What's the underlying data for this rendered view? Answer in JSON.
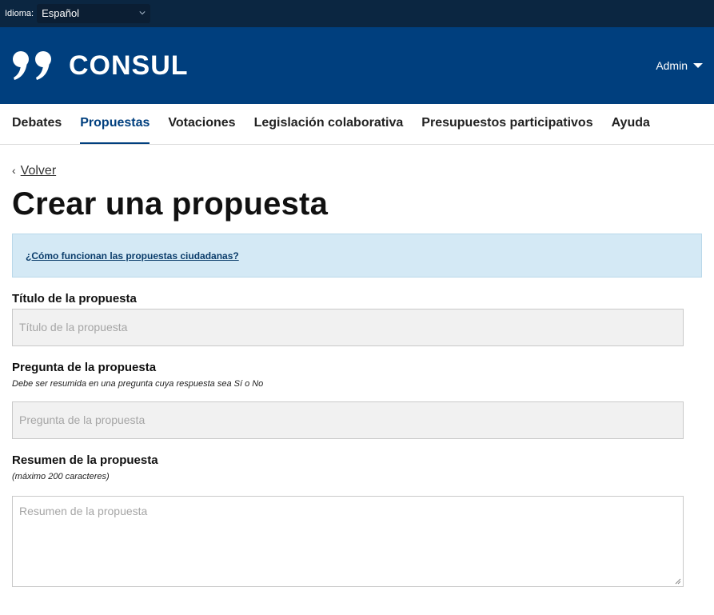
{
  "topbar": {
    "language_label": "Idioma:",
    "language_value": "Español"
  },
  "header": {
    "brand": "CONSUL",
    "admin_label": "Admin"
  },
  "nav": {
    "items": [
      {
        "label": "Debates"
      },
      {
        "label": "Propuestas"
      },
      {
        "label": "Votaciones"
      },
      {
        "label": "Legislación colaborativa"
      },
      {
        "label": "Presupuestos participativos"
      },
      {
        "label": "Ayuda"
      }
    ],
    "active": "Propuestas"
  },
  "page": {
    "back_label": "Volver",
    "title": "Crear una propuesta",
    "callout_link": "¿Cómo funcionan las propuestas ciudadanas?"
  },
  "form": {
    "title_label": "Título de la propuesta",
    "title_placeholder": "Título de la propuesta",
    "question_label": "Pregunta de la propuesta",
    "question_help": "Debe ser resumida en una pregunta cuya respuesta sea Sí o No",
    "question_placeholder": "Pregunta de la propuesta",
    "summary_label": "Resumen de la propuesta",
    "summary_help": "(máximo 200 caracteres)",
    "summary_placeholder": "Resumen de la propuesta"
  },
  "colors": {
    "topbar": "#0b2641",
    "header": "#003f7e",
    "callout": "#d4e9f5"
  }
}
